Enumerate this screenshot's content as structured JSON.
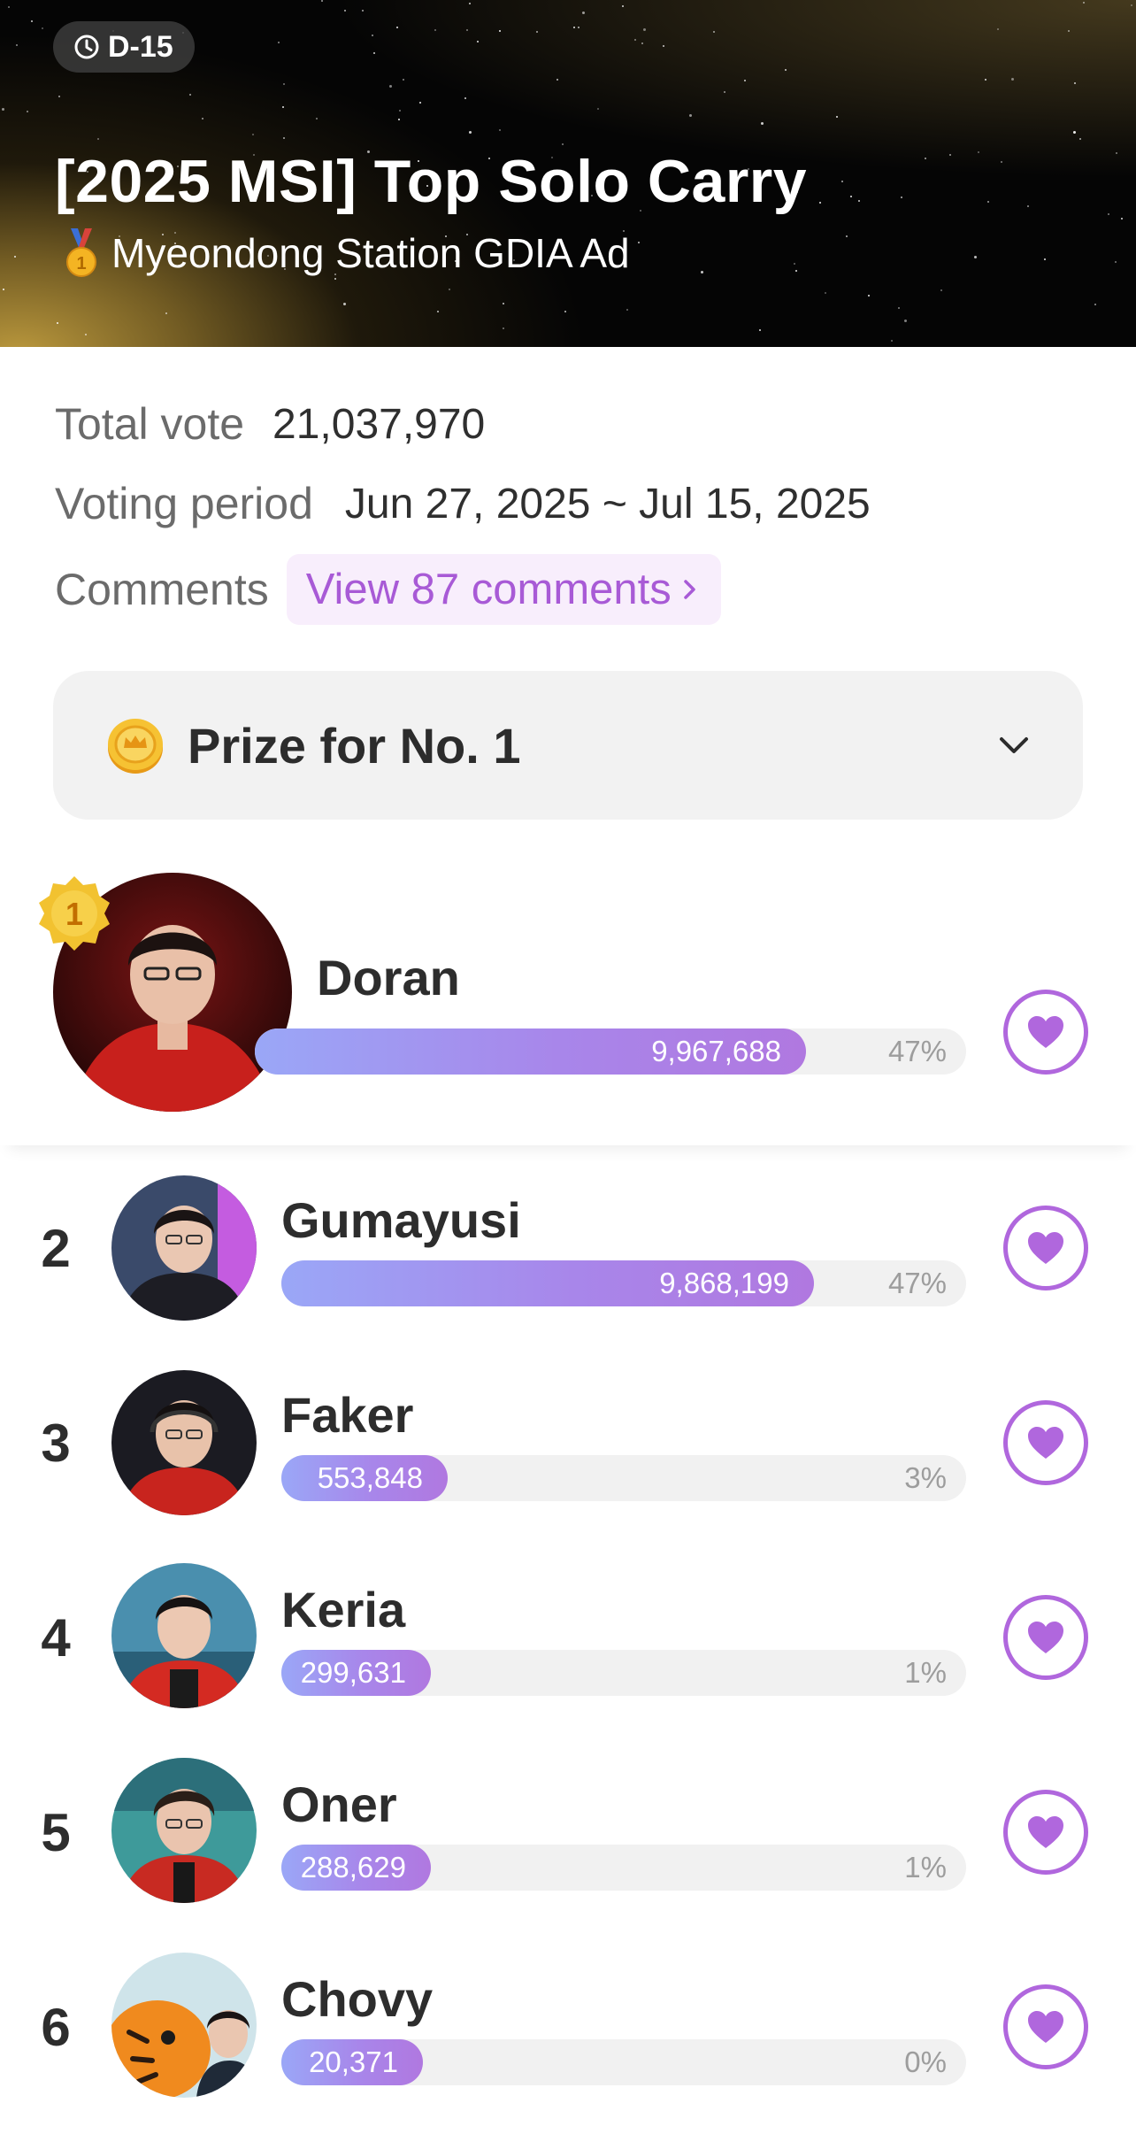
{
  "header": {
    "dday": "D-15",
    "title": "[2025 MSI] Top Solo Carry",
    "subtitle": "Myeondong Station GDIA Ad"
  },
  "info": {
    "total_vote_label": "Total vote",
    "total_vote_value": "21,037,970",
    "voting_period_label": "Voting period",
    "voting_period_value": "Jun 27, 2025 ~ Jul 15, 2025",
    "comments_label": "Comments",
    "comments_link": "View 87 comments"
  },
  "prize": {
    "label": "Prize for No. 1"
  },
  "ranking": [
    {
      "rank": "1",
      "name": "Doran",
      "votes": "9,967,688",
      "percent": "47%",
      "share": 0.47
    },
    {
      "rank": "2",
      "name": "Gumayusi",
      "votes": "9,868,199",
      "percent": "47%",
      "share": 0.47
    },
    {
      "rank": "3",
      "name": "Faker",
      "votes": "553,848",
      "percent": "3%",
      "share": 0.03
    },
    {
      "rank": "4",
      "name": "Keria",
      "votes": "299,631",
      "percent": "1%",
      "share": 0.01
    },
    {
      "rank": "5",
      "name": "Oner",
      "votes": "288,629",
      "percent": "1%",
      "share": 0.01
    },
    {
      "rank": "6",
      "name": "Chovy",
      "votes": "20,371",
      "percent": "0%",
      "share": 0.0
    }
  ],
  "colors": {
    "accent": "#b067dd",
    "bar_start": "#9aa7f7",
    "bar_end": "#b078e0",
    "comments_bg": "#f8eefc",
    "badge_gold": "#f2c230"
  },
  "icons": {
    "dday": "clock-icon",
    "subtitle": "gold-medal-icon",
    "prize": "coin-icon",
    "expand": "chevron-down-icon",
    "vote": "heart-icon"
  }
}
